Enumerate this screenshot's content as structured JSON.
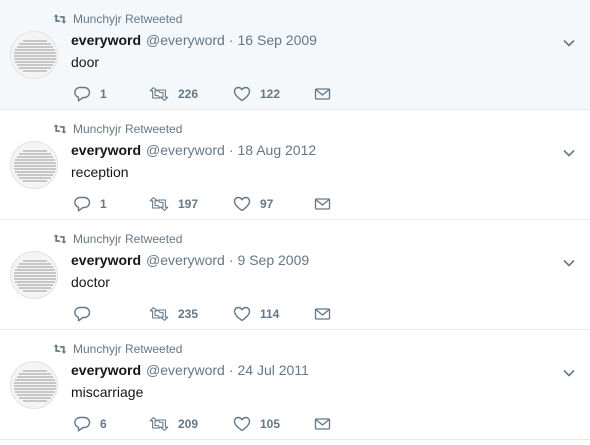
{
  "colors": {
    "secondary_text": "#657786",
    "primary_text": "#14171a",
    "divider": "#e6ecf0"
  },
  "icons": {
    "retweeted_marker": "retweet-icon",
    "reply": "reply-icon",
    "retweet": "retweet-icon",
    "like": "heart-icon",
    "dm": "envelope-icon",
    "menu": "chevron-down-icon"
  },
  "tweets": [
    {
      "retweeted_by": "Munchyjr Retweeted",
      "fullname": "everyword",
      "username": "@everyword",
      "separator": "·",
      "date": "16 Sep 2009",
      "text": "door",
      "replies": "1",
      "retweets": "226",
      "likes": "122"
    },
    {
      "retweeted_by": "Munchyjr Retweeted",
      "fullname": "everyword",
      "username": "@everyword",
      "separator": "·",
      "date": "18 Aug 2012",
      "text": "reception",
      "replies": "1",
      "retweets": "197",
      "likes": "97"
    },
    {
      "retweeted_by": "Munchyjr Retweeted",
      "fullname": "everyword",
      "username": "@everyword",
      "separator": "·",
      "date": "9 Sep 2009",
      "text": "doctor",
      "replies": "",
      "retweets": "235",
      "likes": "114"
    },
    {
      "retweeted_by": "Munchyjr Retweeted",
      "fullname": "everyword",
      "username": "@everyword",
      "separator": "·",
      "date": "24 Jul 2011",
      "text": "miscarriage",
      "replies": "6",
      "retweets": "209",
      "likes": "105"
    }
  ]
}
